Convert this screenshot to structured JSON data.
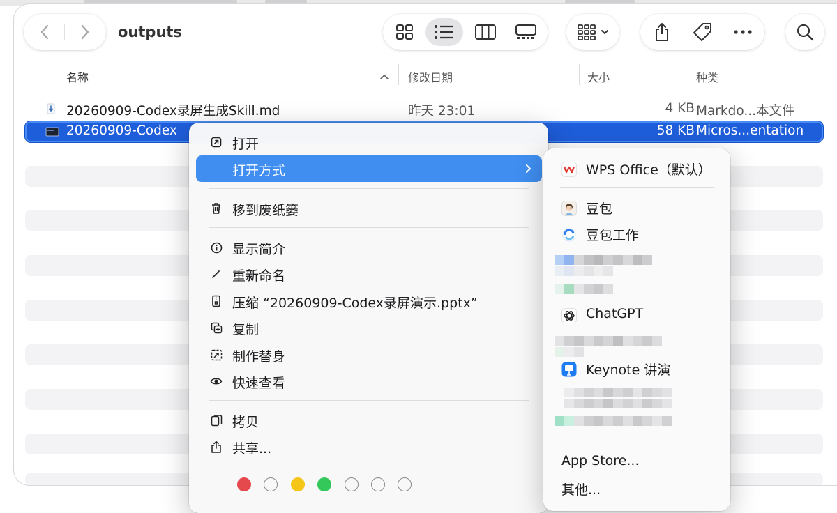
{
  "window": {
    "title": "outputs"
  },
  "toolbar": {
    "back_icon": "chevron-left-icon",
    "forward_icon": "chevron-right-icon",
    "view_modes": [
      "icon-view",
      "list-view",
      "column-view",
      "gallery-view"
    ],
    "active_view": "list-view"
  },
  "columns": {
    "name": "名称",
    "date": "修改日期",
    "size": "大小",
    "kind": "种类"
  },
  "files": [
    {
      "name": "20260909-Codex录屏生成Skill.md",
      "date": "昨天 23:01",
      "size": "4 KB",
      "kind": "Markdo...本文件"
    },
    {
      "name": "20260909-Codex",
      "size": "58 KB",
      "kind": "Micros...entation"
    }
  ],
  "context_menu": {
    "open": "打开",
    "open_with": "打开方式",
    "trash": "移到废纸篓",
    "info": "显示简介",
    "rename": "重新命名",
    "compress": "压缩 “20260909-Codex录屏演示.pptx”",
    "duplicate": "复制",
    "alias": "制作替身",
    "quicklook": "快速查看",
    "copy": "拷贝",
    "share": "共享...",
    "tag_colors": [
      "#e5484d",
      "#ffffff",
      "#f5c518",
      "#34c759",
      "#ffffff",
      "#ffffff",
      "#ffffff"
    ]
  },
  "open_with_menu": {
    "wps": "WPS Office（默认）",
    "doubao": "豆包",
    "doubao_work": "豆包工作",
    "chatgpt": "ChatGPT",
    "keynote": "Keynote 讲演",
    "app_store": "App Store...",
    "other": "其他..."
  }
}
